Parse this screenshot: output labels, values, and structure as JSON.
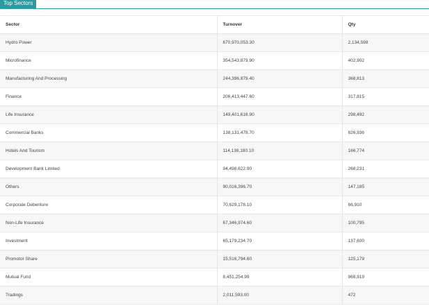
{
  "tab": {
    "label": "Top Sectors"
  },
  "table": {
    "headers": [
      "Sector",
      "Turnover",
      "Qty"
    ],
    "rows": [
      [
        "Hydro Power",
        "670,970,053.30",
        "2,134,598"
      ],
      [
        "Microfinance",
        "354,543,879.90",
        "402,902"
      ],
      [
        "Manufacturing And Processing",
        "244,396,879.40",
        "368,813"
      ],
      [
        "Finance",
        "206,413,447.60",
        "317,815"
      ],
      [
        "Life Insurance",
        "149,401,616.90",
        "298,492"
      ],
      [
        "Commercial Banks",
        "138,131,478.70",
        "626,936"
      ],
      [
        "Hotels And Tourism",
        "114,138,180.10",
        "166,774"
      ],
      [
        "Development Bank Limited",
        "94,498,622.90",
        "268,231"
      ],
      [
        "Others",
        "90,016,396.70",
        "147,185"
      ],
      [
        "Corporate Debenture",
        "70,629,178.10",
        "66,910"
      ],
      [
        "Non-Life Insurance",
        "67,346,974.60",
        "100,795"
      ],
      [
        "Investment",
        "65,179,234.70",
        "137,600"
      ],
      [
        "Promotor Share",
        "15,516,794.60",
        "125,179"
      ],
      [
        "Mutual Fund",
        "8,451,254.99",
        "968,919"
      ],
      [
        "Tradings",
        "2,011,593.00",
        "472"
      ]
    ]
  }
}
